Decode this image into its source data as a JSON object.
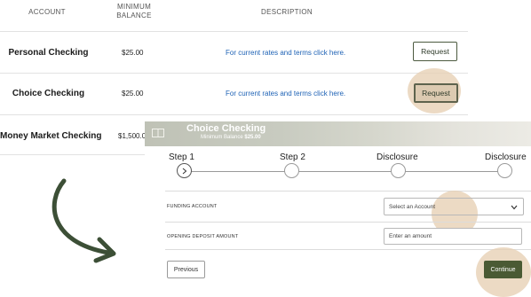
{
  "table": {
    "headers": {
      "account": "ACCOUNT",
      "minimum_balance": "MINIMUM\nBALANCE",
      "description": "DESCRIPTION"
    },
    "rows": [
      {
        "name": "Personal Checking",
        "balance": "$25.00",
        "link": "For current rates and terms click here.",
        "action": "Request"
      },
      {
        "name": "Choice Checking",
        "balance": "$25.00",
        "link": "For current rates and terms click here.",
        "action": "Request"
      },
      {
        "name": "Money Market Checking",
        "balance": "$1,500.0"
      }
    ]
  },
  "panel": {
    "title": "Choice Checking",
    "subtitle_prefix": "Minimum Balance",
    "subtitle_value": "$25.00",
    "steps": [
      "Step 1",
      "Step 2",
      "Disclosure",
      "Disclosure"
    ],
    "current_step_icon": "chevron-right-icon",
    "fields": {
      "funding_account": {
        "label": "FUNDING ACCOUNT",
        "placeholder": "Select an Account"
      },
      "opening_deposit": {
        "label": "OPENING DEPOSIT AMOUNT",
        "placeholder": "Enter an amount"
      }
    },
    "buttons": {
      "previous": "Previous",
      "continue": "Continue"
    }
  },
  "colors": {
    "accent": "#4a5a34",
    "link": "#1e62b5",
    "highlight": "#e7cfb3",
    "arrow": "#3c4f36"
  }
}
